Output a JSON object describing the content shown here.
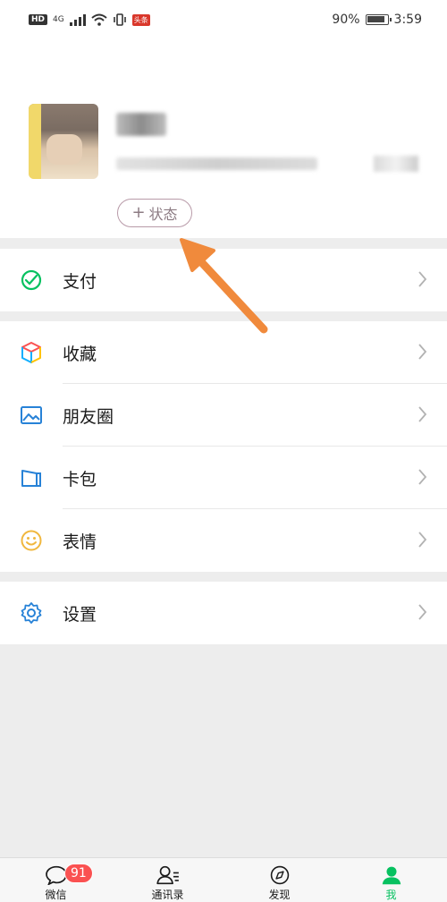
{
  "status_bar": {
    "hd": "HD",
    "network": "4G",
    "app_badge": "头条",
    "battery": "90%",
    "time": "3:59"
  },
  "profile": {
    "status_button_label": "状态"
  },
  "menu": {
    "pay": {
      "label": "支付",
      "icon": "wechat-pay-icon"
    },
    "favorites": {
      "label": "收藏",
      "icon": "favorites-cube-icon"
    },
    "moments": {
      "label": "朋友圈",
      "icon": "moments-image-icon"
    },
    "cards": {
      "label": "卡包",
      "icon": "card-wallet-icon"
    },
    "stickers": {
      "label": "表情",
      "icon": "sticker-smiley-icon"
    },
    "settings": {
      "label": "设置",
      "icon": "settings-gear-icon"
    }
  },
  "tabbar": {
    "chats": {
      "label": "微信",
      "badge": "91"
    },
    "contacts": {
      "label": "通讯录"
    },
    "discover": {
      "label": "发现"
    },
    "me": {
      "label": "我"
    }
  },
  "colors": {
    "accent_green": "#07c160",
    "badge_red": "#fa5151",
    "annotation_orange": "#f08a3c"
  }
}
